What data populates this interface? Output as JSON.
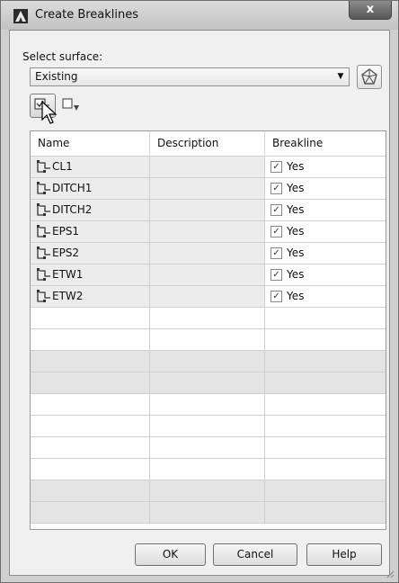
{
  "window": {
    "title": "Create Breaklines",
    "close_label": "x"
  },
  "surface": {
    "label": "Select surface:",
    "value": "Existing"
  },
  "table": {
    "columns": [
      "Name",
      "Description",
      "Breakline"
    ],
    "rows": [
      {
        "name": "CL1",
        "description": "",
        "breakline": "Yes",
        "checked": true
      },
      {
        "name": "DITCH1",
        "description": "",
        "breakline": "Yes",
        "checked": true
      },
      {
        "name": "DITCH2",
        "description": "",
        "breakline": "Yes",
        "checked": true
      },
      {
        "name": "EPS1",
        "description": "",
        "breakline": "Yes",
        "checked": true
      },
      {
        "name": "EPS2",
        "description": "",
        "breakline": "Yes",
        "checked": true
      },
      {
        "name": "ETW1",
        "description": "",
        "breakline": "Yes",
        "checked": true
      },
      {
        "name": "ETW2",
        "description": "",
        "breakline": "Yes",
        "checked": true
      }
    ],
    "empty_rows": 10
  },
  "buttons": {
    "ok": "OK",
    "cancel": "Cancel",
    "help": "Help"
  },
  "icons": {
    "app": "autocad-icon",
    "surface_pick": "surface-pick-icon",
    "select": "select-from-drawing-icon",
    "add": "add-item-icon",
    "breakline_item": "breakline-icon",
    "checkbox": "checkbox-checked-icon"
  }
}
